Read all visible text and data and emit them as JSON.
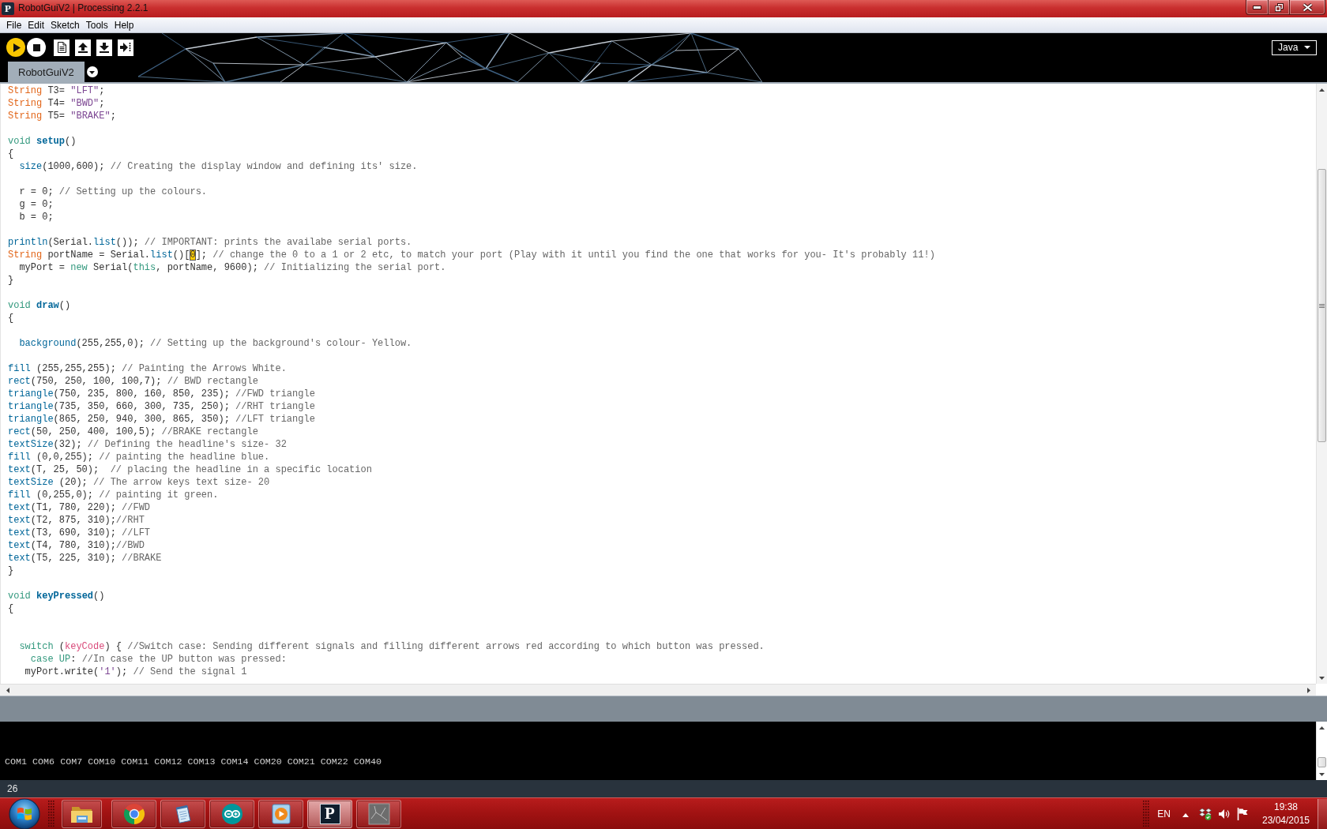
{
  "window": {
    "title": "RobotGuiV2 | Processing 2.2.1",
    "logo_letter": "P"
  },
  "menu_bar": [
    "File",
    "Edit",
    "Sketch",
    "Tools",
    "Help"
  ],
  "toolbar": {
    "mode": "Java"
  },
  "tabs": [
    {
      "label": "RobotGuiV2",
      "selected": true
    }
  ],
  "editor": {
    "lines": [
      {
        "kind": "code",
        "tokens": [
          {
            "kind": "type",
            "text": "String"
          },
          {
            "kind": "plain",
            "text": " T3= "
          },
          {
            "kind": "string",
            "text": "\"LFT\""
          },
          {
            "kind": "plain",
            "text": ";"
          }
        ]
      },
      {
        "kind": "code",
        "tokens": [
          {
            "kind": "type",
            "text": "String"
          },
          {
            "kind": "plain",
            "text": " T4= "
          },
          {
            "kind": "string",
            "text": "\"BWD\""
          },
          {
            "kind": "plain",
            "text": ";"
          }
        ]
      },
      {
        "kind": "code",
        "tokens": [
          {
            "kind": "type",
            "text": "String"
          },
          {
            "kind": "plain",
            "text": " T5= "
          },
          {
            "kind": "string",
            "text": "\"BRAKE\""
          },
          {
            "kind": "plain",
            "text": ";"
          }
        ]
      },
      {
        "kind": "blank"
      },
      {
        "kind": "code",
        "tokens": [
          {
            "kind": "keyword",
            "text": "void "
          },
          {
            "kind": "function_name",
            "text": "setup"
          },
          {
            "kind": "plain",
            "text": "()"
          }
        ]
      },
      {
        "kind": "code",
        "tokens": [
          {
            "kind": "plain",
            "text": "{"
          }
        ]
      },
      {
        "kind": "code",
        "tokens": [
          {
            "kind": "call",
            "text": "  size"
          },
          {
            "kind": "plain",
            "text": "(1000,600); "
          },
          {
            "kind": "comment",
            "text": "// Creating the display window and defining its' size."
          }
        ]
      },
      {
        "kind": "blank"
      },
      {
        "kind": "code",
        "tokens": [
          {
            "kind": "plain",
            "text": "  r = 0; "
          },
          {
            "kind": "comment",
            "text": "// Setting up the colours."
          }
        ]
      },
      {
        "kind": "code",
        "tokens": [
          {
            "kind": "plain",
            "text": "  g = 0;"
          }
        ]
      },
      {
        "kind": "code",
        "tokens": [
          {
            "kind": "plain",
            "text": "  b = 0;"
          }
        ]
      },
      {
        "kind": "blank"
      },
      {
        "kind": "code",
        "tokens": [
          {
            "kind": "call",
            "text": "println"
          },
          {
            "kind": "plain",
            "text": "(Serial."
          },
          {
            "kind": "call",
            "text": "list"
          },
          {
            "kind": "plain",
            "text": "()); "
          },
          {
            "kind": "comment",
            "text": "// IMPORTANT: prints the availabe serial ports."
          }
        ]
      },
      {
        "kind": "code",
        "tokens": [
          {
            "kind": "type",
            "text": "String"
          },
          {
            "kind": "plain",
            "text": " portName = Serial."
          },
          {
            "kind": "call",
            "text": "list"
          },
          {
            "kind": "plain",
            "text": "()["
          },
          {
            "kind": "highlight",
            "text": "0"
          },
          {
            "kind": "plain",
            "text": "]; "
          },
          {
            "kind": "comment",
            "text": "// change the 0 to a 1 or 2 etc, to match your port (Play with it until you find the one that works for you- It's probably 11!)"
          }
        ]
      },
      {
        "kind": "code",
        "tokens": [
          {
            "kind": "plain",
            "text": "  myPort = "
          },
          {
            "kind": "keyword",
            "text": "new"
          },
          {
            "kind": "plain",
            "text": " Serial("
          },
          {
            "kind": "keyword",
            "text": "this"
          },
          {
            "kind": "plain",
            "text": ", portName, 9600); "
          },
          {
            "kind": "comment",
            "text": "// Initializing the serial port."
          }
        ]
      },
      {
        "kind": "code",
        "tokens": [
          {
            "kind": "plain",
            "text": "}"
          }
        ]
      },
      {
        "kind": "blank"
      },
      {
        "kind": "code",
        "tokens": [
          {
            "kind": "keyword",
            "text": "void "
          },
          {
            "kind": "function_name",
            "text": "draw"
          },
          {
            "kind": "plain",
            "text": "()"
          }
        ]
      },
      {
        "kind": "code",
        "tokens": [
          {
            "kind": "plain",
            "text": "{"
          }
        ]
      },
      {
        "kind": "blank"
      },
      {
        "kind": "code",
        "tokens": [
          {
            "kind": "call",
            "text": "  background"
          },
          {
            "kind": "plain",
            "text": "(255,255,0); "
          },
          {
            "kind": "comment",
            "text": "// Setting up the background's colour- Yellow."
          }
        ]
      },
      {
        "kind": "blank"
      },
      {
        "kind": "code",
        "tokens": [
          {
            "kind": "call",
            "text": "fill"
          },
          {
            "kind": "plain",
            "text": " (255,255,255); "
          },
          {
            "kind": "comment",
            "text": "// Painting the Arrows White."
          }
        ]
      },
      {
        "kind": "code",
        "tokens": [
          {
            "kind": "call",
            "text": "rect"
          },
          {
            "kind": "plain",
            "text": "(750, 250, 100, 100,7); "
          },
          {
            "kind": "comment",
            "text": "// BWD rectangle"
          }
        ]
      },
      {
        "kind": "code",
        "tokens": [
          {
            "kind": "call",
            "text": "triangle"
          },
          {
            "kind": "plain",
            "text": "(750, 235, 800, 160, 850, 235); "
          },
          {
            "kind": "comment",
            "text": "//FWD triangle"
          }
        ]
      },
      {
        "kind": "code",
        "tokens": [
          {
            "kind": "call",
            "text": "triangle"
          },
          {
            "kind": "plain",
            "text": "(735, 350, 660, 300, 735, 250); "
          },
          {
            "kind": "comment",
            "text": "//RHT triangle"
          }
        ]
      },
      {
        "kind": "code",
        "tokens": [
          {
            "kind": "call",
            "text": "triangle"
          },
          {
            "kind": "plain",
            "text": "(865, 250, 940, 300, 865, 350); "
          },
          {
            "kind": "comment",
            "text": "//LFT triangle"
          }
        ]
      },
      {
        "kind": "code",
        "tokens": [
          {
            "kind": "call",
            "text": "rect"
          },
          {
            "kind": "plain",
            "text": "(50, 250, 400, 100,5); "
          },
          {
            "kind": "comment",
            "text": "//BRAKE rectangle"
          }
        ]
      },
      {
        "kind": "code",
        "tokens": [
          {
            "kind": "call",
            "text": "textSize"
          },
          {
            "kind": "plain",
            "text": "(32); "
          },
          {
            "kind": "comment",
            "text": "// Defining the headline's size- 32"
          }
        ]
      },
      {
        "kind": "code",
        "tokens": [
          {
            "kind": "call",
            "text": "fill"
          },
          {
            "kind": "plain",
            "text": " (0,0,255); "
          },
          {
            "kind": "comment",
            "text": "// painting the headline blue."
          }
        ]
      },
      {
        "kind": "code",
        "tokens": [
          {
            "kind": "call",
            "text": "text"
          },
          {
            "kind": "plain",
            "text": "(T, 25, 50);  "
          },
          {
            "kind": "comment",
            "text": "// placing the headline in a specific location"
          }
        ]
      },
      {
        "kind": "code",
        "tokens": [
          {
            "kind": "call",
            "text": "textSize"
          },
          {
            "kind": "plain",
            "text": " (20); "
          },
          {
            "kind": "comment",
            "text": "// The arrow keys text size- 20"
          }
        ]
      },
      {
        "kind": "code",
        "tokens": [
          {
            "kind": "call",
            "text": "fill"
          },
          {
            "kind": "plain",
            "text": " (0,255,0); "
          },
          {
            "kind": "comment",
            "text": "// painting it green."
          }
        ]
      },
      {
        "kind": "code",
        "tokens": [
          {
            "kind": "call",
            "text": "text"
          },
          {
            "kind": "plain",
            "text": "(T1, 780, 220); "
          },
          {
            "kind": "comment",
            "text": "//FWD"
          }
        ]
      },
      {
        "kind": "code",
        "tokens": [
          {
            "kind": "call",
            "text": "text"
          },
          {
            "kind": "plain",
            "text": "(T2, 875, 310);"
          },
          {
            "kind": "comment",
            "text": "//RHT"
          }
        ]
      },
      {
        "kind": "code",
        "tokens": [
          {
            "kind": "call",
            "text": "text"
          },
          {
            "kind": "plain",
            "text": "(T3, 690, 310); "
          },
          {
            "kind": "comment",
            "text": "//LFT"
          }
        ]
      },
      {
        "kind": "code",
        "tokens": [
          {
            "kind": "call",
            "text": "text"
          },
          {
            "kind": "plain",
            "text": "(T4, 780, 310);"
          },
          {
            "kind": "comment",
            "text": "//BWD"
          }
        ]
      },
      {
        "kind": "code",
        "tokens": [
          {
            "kind": "call",
            "text": "text"
          },
          {
            "kind": "plain",
            "text": "(T5, 225, 310); "
          },
          {
            "kind": "comment",
            "text": "//BRAKE"
          }
        ]
      },
      {
        "kind": "code",
        "tokens": [
          {
            "kind": "plain",
            "text": "}"
          }
        ]
      },
      {
        "kind": "blank"
      },
      {
        "kind": "code",
        "tokens": [
          {
            "kind": "keyword",
            "text": "void "
          },
          {
            "kind": "function_name",
            "text": "keyPressed"
          },
          {
            "kind": "plain",
            "text": "()"
          }
        ]
      },
      {
        "kind": "code",
        "tokens": [
          {
            "kind": "plain",
            "text": "{"
          }
        ]
      },
      {
        "kind": "blank"
      },
      {
        "kind": "blank"
      },
      {
        "kind": "code",
        "tokens": [
          {
            "kind": "keyword",
            "text": "  switch"
          },
          {
            "kind": "plain",
            "text": " ("
          },
          {
            "kind": "variable",
            "text": "keyCode"
          },
          {
            "kind": "plain",
            "text": ") { "
          },
          {
            "kind": "comment",
            "text": "//Switch case: Sending different signals and filling different arrows red according to which button was pressed."
          }
        ]
      },
      {
        "kind": "code",
        "tokens": [
          {
            "kind": "keyword",
            "text": "    case UP"
          },
          {
            "kind": "plain",
            "text": ": "
          },
          {
            "kind": "comment",
            "text": "//In case the UP button was pressed:"
          }
        ]
      },
      {
        "kind": "code",
        "tokens": [
          {
            "kind": "plain",
            "text": "   myPort.write("
          },
          {
            "kind": "string",
            "text": "'1'"
          },
          {
            "kind": "plain",
            "text": "); "
          },
          {
            "kind": "comment",
            "text": "// Send the signal 1"
          }
        ]
      }
    ]
  },
  "console": {
    "lines": [
      "COM1 COM6 COM7 COM10 COM11 COM12 COM13 COM14 COM20 COM21 COM22 COM40"
    ]
  },
  "status_bar": {
    "line_number": "26"
  },
  "taskbar": {
    "items": [
      {
        "kind": "folder",
        "selected": false
      },
      {
        "kind": "globe",
        "selected": false
      },
      {
        "kind": "notepad",
        "selected": false
      },
      {
        "kind": "infinity",
        "selected": false
      },
      {
        "kind": "play",
        "selected": false
      },
      {
        "kind": "letter",
        "logo_letter": "P",
        "selected": true
      },
      {
        "kind": "image",
        "selected": false
      }
    ],
    "tray": {
      "language": "EN",
      "time": "19:38",
      "date": "23/04/2015"
    }
  }
}
